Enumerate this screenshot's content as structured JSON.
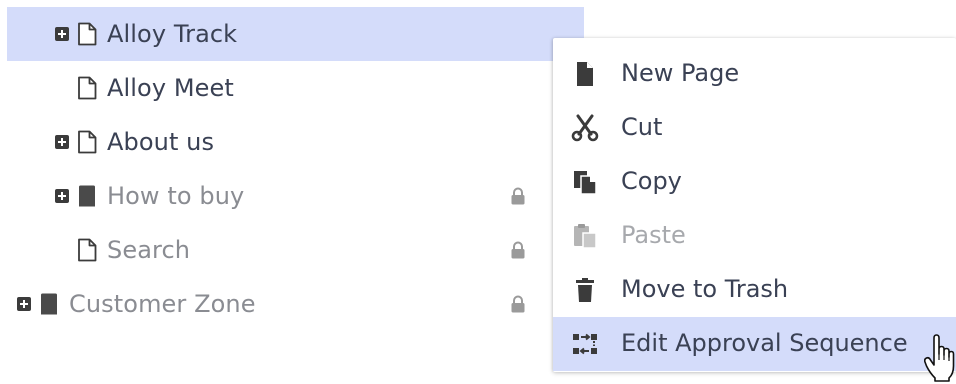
{
  "tree": {
    "items": [
      {
        "label": "Alloy Track",
        "expandable": true,
        "icon": "page-icon",
        "selected": true,
        "locked": false
      },
      {
        "label": "Alloy Meet",
        "expandable": false,
        "icon": "page-icon",
        "selected": false,
        "locked": false
      },
      {
        "label": "About us",
        "expandable": true,
        "icon": "page-icon",
        "selected": false,
        "locked": false
      },
      {
        "label": "How to buy",
        "expandable": true,
        "icon": "container-icon",
        "selected": false,
        "locked": true
      },
      {
        "label": "Search",
        "expandable": false,
        "icon": "page-icon",
        "selected": false,
        "locked": true
      },
      {
        "label": "Customer Zone",
        "expandable": true,
        "icon": "container-icon",
        "selected": false,
        "locked": true
      }
    ]
  },
  "context_menu": {
    "items": [
      {
        "label": "New Page",
        "icon": "new-page-icon",
        "enabled": true
      },
      {
        "label": "Cut",
        "icon": "scissors-icon",
        "enabled": true
      },
      {
        "label": "Copy",
        "icon": "copy-icon",
        "enabled": true
      },
      {
        "label": "Paste",
        "icon": "paste-icon",
        "enabled": false
      },
      {
        "label": "Move to Trash",
        "icon": "trash-icon",
        "enabled": true
      },
      {
        "label": "Edit Approval Sequence",
        "icon": "approval-sequence-icon",
        "enabled": true,
        "hovered": true
      }
    ]
  },
  "colors": {
    "selection": "#d4dcfa",
    "text": "#3a4154",
    "muted_text": "#8a8c92",
    "disabled_text": "#a7a9ad",
    "icon": "#3b3b3b"
  }
}
